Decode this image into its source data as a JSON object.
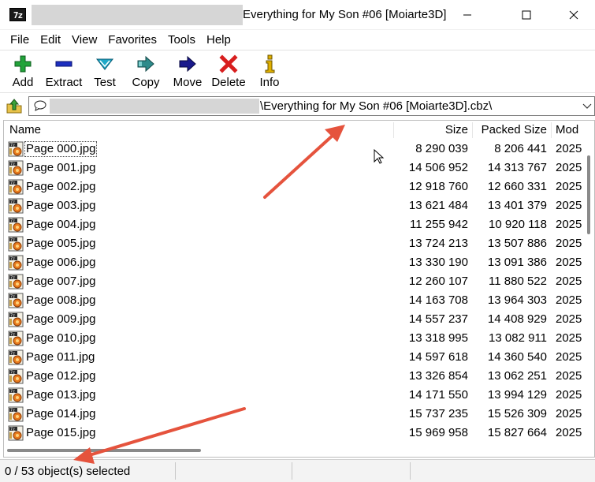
{
  "window": {
    "title": "Everything for My Son #06 [Moiarte3D]",
    "app_icon_text": "7z",
    "controls": [
      "minimize-icon",
      "maximize-icon",
      "close-icon"
    ]
  },
  "menu": [
    "File",
    "Edit",
    "View",
    "Favorites",
    "Tools",
    "Help"
  ],
  "toolbar": [
    {
      "label": "Add",
      "icon": "add-icon",
      "color": "#22a33a"
    },
    {
      "label": "Extract",
      "icon": "extract-icon",
      "color": "#1d2fc0"
    },
    {
      "label": "Test",
      "icon": "test-icon",
      "color": "#1fa9c8"
    },
    {
      "label": "Copy",
      "icon": "copy-icon",
      "color": "#2e8b8b"
    },
    {
      "label": "Move",
      "icon": "move-icon",
      "color": "#1a1a8c"
    },
    {
      "label": "Delete",
      "icon": "delete-icon",
      "color": "#d81e1e"
    },
    {
      "label": "Info",
      "icon": "info-icon",
      "color": "#e0b000"
    }
  ],
  "address": {
    "path": "\\Everything for My Son #06 [Moiarte3D].cbz\\"
  },
  "columns": {
    "name": "Name",
    "size": "Size",
    "packed": "Packed Size",
    "modified": "Mod"
  },
  "files": [
    {
      "name": "Page 000.jpg",
      "size": "8 290 039",
      "packed": "8 206 441",
      "modified": "2025"
    },
    {
      "name": "Page 001.jpg",
      "size": "14 506 952",
      "packed": "14 313 767",
      "modified": "2025"
    },
    {
      "name": "Page 002.jpg",
      "size": "12 918 760",
      "packed": "12 660 331",
      "modified": "2025"
    },
    {
      "name": "Page 003.jpg",
      "size": "13 621 484",
      "packed": "13 401 379",
      "modified": "2025"
    },
    {
      "name": "Page 004.jpg",
      "size": "11 255 942",
      "packed": "10 920 118",
      "modified": "2025"
    },
    {
      "name": "Page 005.jpg",
      "size": "13 724 213",
      "packed": "13 507 886",
      "modified": "2025"
    },
    {
      "name": "Page 006.jpg",
      "size": "13 330 190",
      "packed": "13 091 386",
      "modified": "2025"
    },
    {
      "name": "Page 007.jpg",
      "size": "12 260 107",
      "packed": "11 880 522",
      "modified": "2025"
    },
    {
      "name": "Page 008.jpg",
      "size": "14 163 708",
      "packed": "13 964 303",
      "modified": "2025"
    },
    {
      "name": "Page 009.jpg",
      "size": "14 557 237",
      "packed": "14 408 929",
      "modified": "2025"
    },
    {
      "name": "Page 010.jpg",
      "size": "13 318 995",
      "packed": "13 082 911",
      "modified": "2025"
    },
    {
      "name": "Page 011.jpg",
      "size": "14 597 618",
      "packed": "14 360 540",
      "modified": "2025"
    },
    {
      "name": "Page 012.jpg",
      "size": "13 326 854",
      "packed": "13 062 251",
      "modified": "2025"
    },
    {
      "name": "Page 013.jpg",
      "size": "14 171 550",
      "packed": "13 994 129",
      "modified": "2025"
    },
    {
      "name": "Page 014.jpg",
      "size": "15 737 235",
      "packed": "15 526 309",
      "modified": "2025"
    },
    {
      "name": "Page 015.jpg",
      "size": "15 969 958",
      "packed": "15 827 664",
      "modified": "2025"
    }
  ],
  "status": {
    "selected": "0 / 53 object(s) selected"
  },
  "annotation": {
    "arrow_color": "#e5533d"
  }
}
